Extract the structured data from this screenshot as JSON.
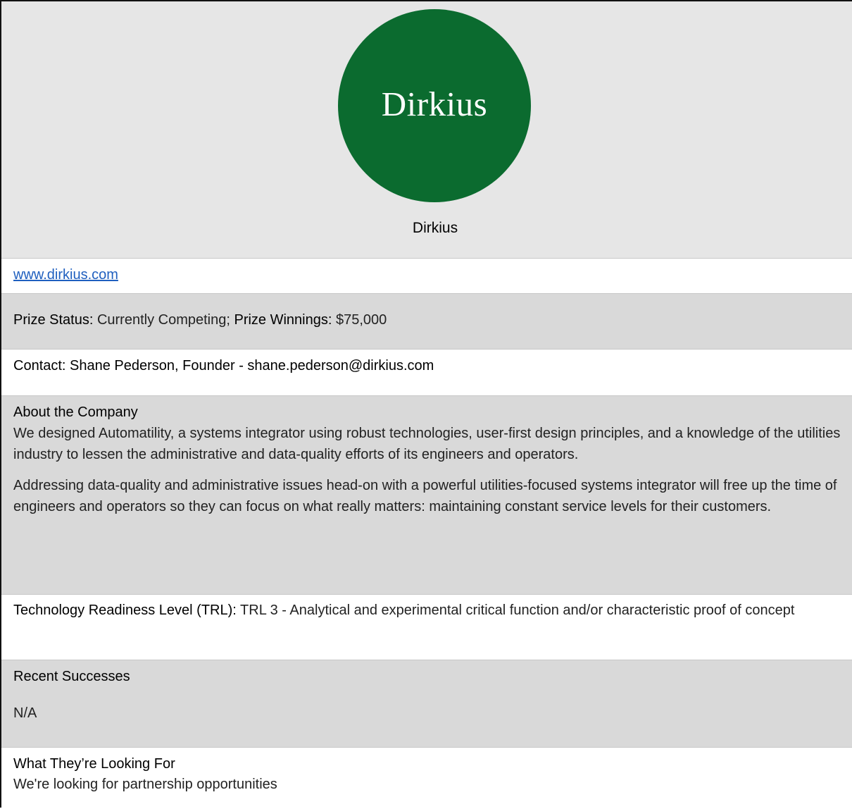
{
  "header": {
    "logo_text": "Dirkius",
    "company_name": "Dirkius",
    "logo_color": "#0b6b2f"
  },
  "website": {
    "url": "www.dirkius.com"
  },
  "prize": {
    "status_label": "Prize Status:",
    "status_value": "Currently Competing;",
    "winnings_label": "Prize Winnings:",
    "winnings_value": "$75,000"
  },
  "contact": {
    "text": "Contact: Shane Pederson, Founder - shane.pederson@dirkius.com"
  },
  "about": {
    "heading": "About the Company",
    "paragraph_1": "We designed Automatility, a systems integrator using robust technologies, user-first design principles, and a knowledge of the utilities industry to lessen the administrative and data-quality efforts of its engineers and operators.",
    "paragraph_2": "Addressing data-quality and administrative issues head-on with a powerful utilities-focused systems integrator will free up the time of engineers and operators so they can focus on what really matters: maintaining constant service levels for their customers."
  },
  "trl": {
    "label": "Technology Readiness Level (TRL):",
    "value": "TRL 3 - Analytical and experimental critical function and/or characteristic proof of concept"
  },
  "recent_successes": {
    "heading": "Recent Successes",
    "value": "N/A"
  },
  "looking_for": {
    "heading": "What They’re Looking For",
    "value": "We're looking for partnership opportunities"
  }
}
